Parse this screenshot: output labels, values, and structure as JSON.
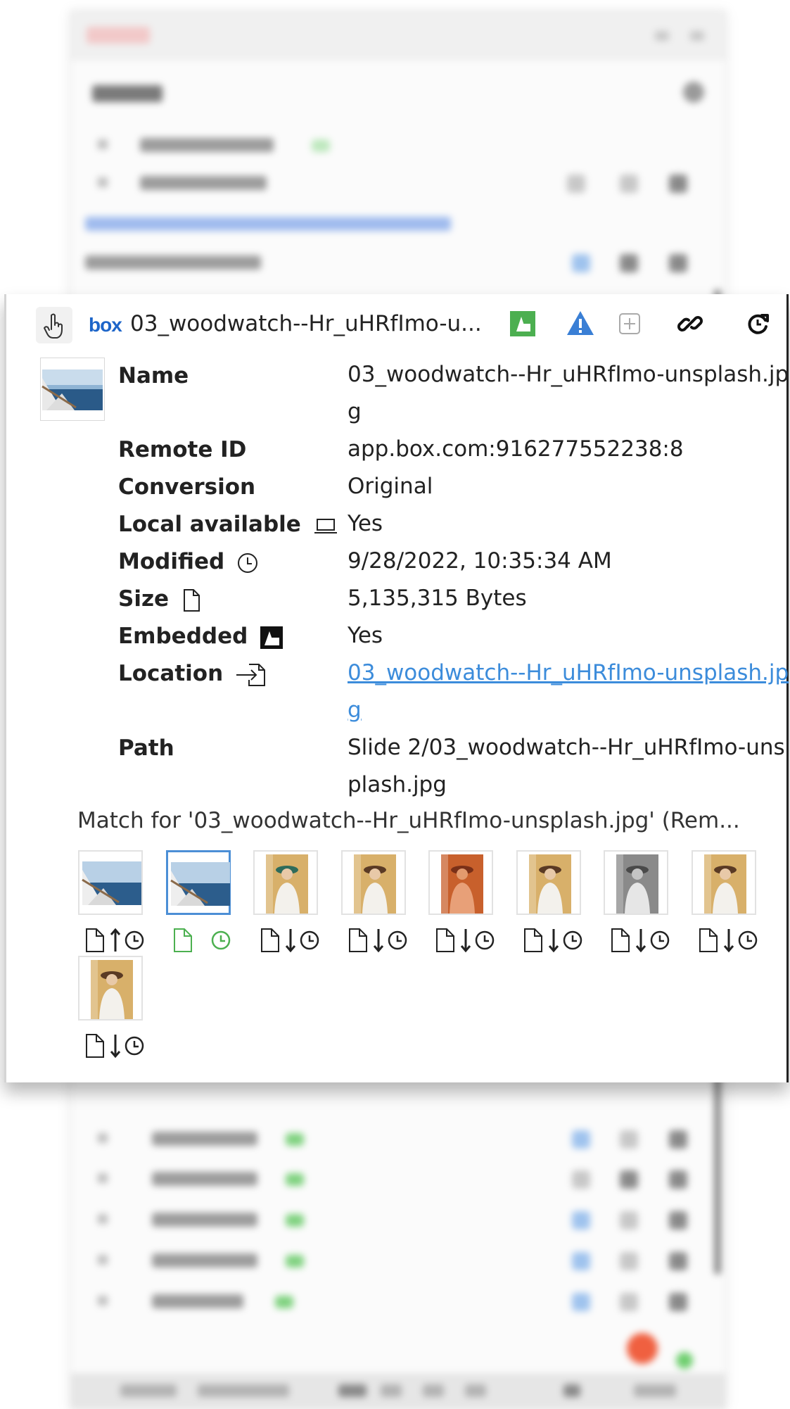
{
  "panel": {
    "file_title": "03_woodwatch--Hr_uHRfImo-u...",
    "provider_logo": "box",
    "header_icons": [
      "hand-pointer-icon",
      "box-logo",
      "embedded-green-icon",
      "warning-icon",
      "add-square-icon",
      "link-icon",
      "refresh-icon"
    ],
    "properties": [
      {
        "label": "Name",
        "value": "03_woodwatch--Hr_uHRfImo-unsplash.jpg",
        "icon": ""
      },
      {
        "label": "Remote ID",
        "value": "app.box.com:916277552238:8",
        "icon": ""
      },
      {
        "label": "Conversion",
        "value": "Original",
        "icon": ""
      },
      {
        "label": "Local available",
        "value": "Yes",
        "icon": "laptop-icon"
      },
      {
        "label": "Modified",
        "value": "9/28/2022, 10:35:34 AM",
        "icon": "clock-icon"
      },
      {
        "label": "Size",
        "value": "5,135,315 Bytes",
        "icon": "file-icon"
      },
      {
        "label": "Embedded",
        "value": "Yes",
        "icon": "embedded-icon"
      },
      {
        "label": "Location",
        "value": "03_woodwatch--Hr_uHRfImo-unsplash.jpg",
        "icon": "location-icon",
        "is_link": true
      },
      {
        "label": "Path",
        "value": "Slide 2/03_woodwatch--Hr_uHRfImo-unsplash.jpg",
        "icon": ""
      }
    ],
    "match_text": "Match for '03_woodwatch--Hr_uHRfImo-unsplash.jpg' (Rem...",
    "thumbnails": [
      {
        "image": "sailboat",
        "direction": "up",
        "selected": false
      },
      {
        "image": "sailboat",
        "direction": "none",
        "selected": true
      },
      {
        "image": "woman-hat-green",
        "direction": "down",
        "selected": false
      },
      {
        "image": "woman-hat",
        "direction": "down",
        "selected": false
      },
      {
        "image": "woman-orange",
        "direction": "down",
        "selected": false
      },
      {
        "image": "woman-hat",
        "direction": "down",
        "selected": false
      },
      {
        "image": "woman-grayscale",
        "direction": "down",
        "selected": false
      },
      {
        "image": "woman-hat",
        "direction": "down",
        "selected": false
      },
      {
        "image": "woman-hat",
        "direction": "down",
        "selected": false
      }
    ]
  },
  "colors": {
    "accent_blue": "#4c8fd6",
    "link": "#3c8cdb",
    "selected_green": "#4cb050",
    "warning_blue": "#3a7fd5",
    "embedded_green": "#4caf50",
    "box_blue": "#1d65c9"
  }
}
